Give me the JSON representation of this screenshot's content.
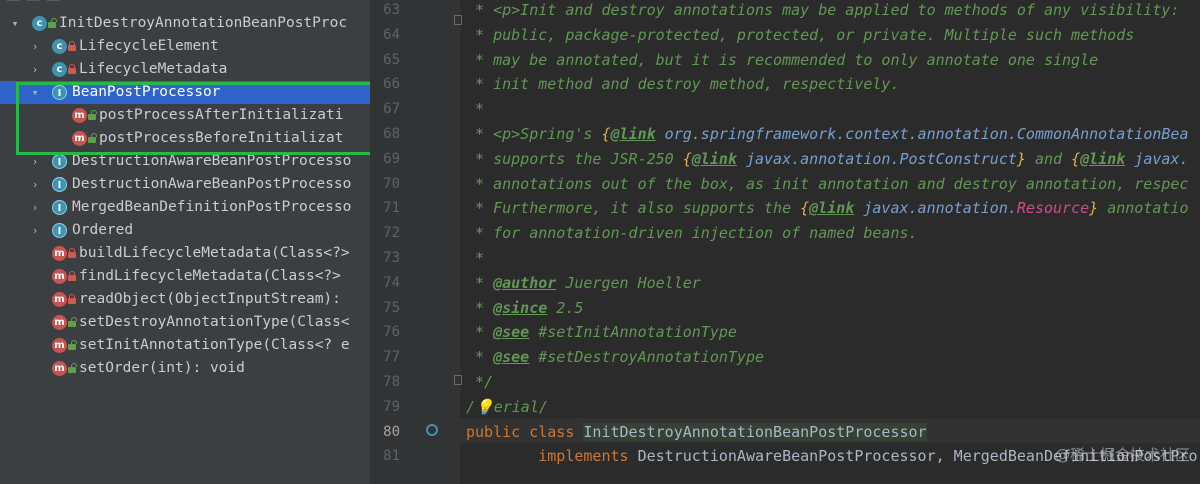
{
  "structure": {
    "items": [
      {
        "label": "InitDestroyAnnotationBeanPostProc",
        "arrow": "▾",
        "icon": "class-icon",
        "lock": "green",
        "indent": 0
      },
      {
        "label": "LifecycleElement",
        "arrow": "›",
        "icon": "class-icon",
        "lock": "red",
        "indent": 1
      },
      {
        "label": "LifecycleMetadata",
        "arrow": "›",
        "icon": "class-icon",
        "lock": "red",
        "indent": 1
      },
      {
        "label": "BeanPostProcessor",
        "arrow": "▾",
        "icon": "interface-icon",
        "lock": "",
        "indent": 1,
        "selected": true
      },
      {
        "label": "postProcessAfterInitializati",
        "arrow": "",
        "icon": "method-icon",
        "lock": "green",
        "indent": 2
      },
      {
        "label": "postProcessBeforeInitializat",
        "arrow": "",
        "icon": "method-icon",
        "lock": "green",
        "indent": 2
      },
      {
        "label": "DestructionAwareBeanPostProcesso",
        "arrow": "›",
        "icon": "interface-icon",
        "lock": "",
        "indent": 1
      },
      {
        "label": "DestructionAwareBeanPostProcesso",
        "arrow": "›",
        "icon": "interface-icon",
        "lock": "",
        "indent": 1
      },
      {
        "label": "MergedBeanDefinitionPostProcesso",
        "arrow": "›",
        "icon": "interface-icon",
        "lock": "",
        "indent": 1
      },
      {
        "label": "Ordered",
        "arrow": "›",
        "icon": "interface-icon",
        "lock": "",
        "indent": 1
      },
      {
        "label": "buildLifecycleMetadata(Class<?>",
        "arrow": "",
        "icon": "method-icon",
        "lock": "red",
        "indent": 1
      },
      {
        "label": "findLifecycleMetadata(Class<?>",
        "arrow": "",
        "icon": "method-icon",
        "lock": "red",
        "indent": 1
      },
      {
        "label": "readObject(ObjectInputStream):",
        "arrow": "",
        "icon": "method-icon",
        "lock": "red",
        "indent": 1
      },
      {
        "label": "setDestroyAnnotationType(Class<",
        "arrow": "",
        "icon": "method-icon",
        "lock": "green",
        "indent": 1
      },
      {
        "label": "setInitAnnotationType(Class<? e",
        "arrow": "",
        "icon": "method-icon",
        "lock": "green",
        "indent": 1
      },
      {
        "label": "setOrder(int): void",
        "arrow": "",
        "icon": "method-icon",
        "lock": "green",
        "indent": 1
      }
    ]
  },
  "editor": {
    "lines": [
      {
        "n": "63",
        "parts": [
          [
            "doc",
            " * <p>Init and destroy annotations may be applied to methods of any visibility:"
          ]
        ]
      },
      {
        "n": "64",
        "parts": [
          [
            "doc",
            " * public, package-protected, protected, or private. Multiple such methods"
          ]
        ]
      },
      {
        "n": "65",
        "parts": [
          [
            "doc",
            " * may be annotated, but it is recommended to only annotate one single"
          ]
        ]
      },
      {
        "n": "66",
        "parts": [
          [
            "doc",
            " * init method and destroy method, respectively."
          ]
        ]
      },
      {
        "n": "67",
        "parts": [
          [
            "doc",
            " *"
          ]
        ]
      },
      {
        "n": "68",
        "parts": [
          [
            "doc",
            " * <p>Spring's "
          ],
          [
            "brace",
            "{"
          ],
          [
            "linktag",
            "@link"
          ],
          [
            "link",
            " org.springframework.context.annotation.CommonAnnotationBea"
          ]
        ]
      },
      {
        "n": "69",
        "parts": [
          [
            "doc",
            " * supports the JSR-250 "
          ],
          [
            "brace",
            "{"
          ],
          [
            "linktag",
            "@link"
          ],
          [
            "link",
            " javax.annotation.PostConstruct"
          ],
          [
            "brace",
            "}"
          ],
          [
            "doc",
            " and "
          ],
          [
            "brace",
            "{"
          ],
          [
            "linktag",
            "@link"
          ],
          [
            "link",
            " javax."
          ]
        ]
      },
      {
        "n": "70",
        "parts": [
          [
            "doc",
            " * annotations out of the box, as init annotation and destroy annotation, respec"
          ]
        ]
      },
      {
        "n": "71",
        "parts": [
          [
            "doc",
            " * Furthermore, it also supports the "
          ],
          [
            "brace",
            "{"
          ],
          [
            "linktag",
            "@link"
          ],
          [
            "link",
            " javax.annotation."
          ],
          [
            "pink",
            "Resource"
          ],
          [
            "brace",
            "}"
          ],
          [
            "doc",
            " annotatio"
          ]
        ]
      },
      {
        "n": "72",
        "parts": [
          [
            "doc",
            " * for annotation-driven injection of named beans."
          ]
        ]
      },
      {
        "n": "73",
        "parts": [
          [
            "doc",
            " *"
          ]
        ]
      },
      {
        "n": "74",
        "parts": [
          [
            "doc",
            " * "
          ],
          [
            "tag",
            "@author"
          ],
          [
            "doc",
            " Juergen Hoeller"
          ]
        ]
      },
      {
        "n": "75",
        "parts": [
          [
            "doc",
            " * "
          ],
          [
            "tag",
            "@since"
          ],
          [
            "doc",
            " 2.5"
          ]
        ]
      },
      {
        "n": "76",
        "parts": [
          [
            "doc",
            " * "
          ],
          [
            "tag",
            "@see"
          ],
          [
            "doc",
            " #setInitAnnotationType"
          ]
        ]
      },
      {
        "n": "77",
        "parts": [
          [
            "doc",
            " * "
          ],
          [
            "tag",
            "@see"
          ],
          [
            "doc",
            " #setDestroyAnnotationType"
          ]
        ]
      },
      {
        "n": "78",
        "parts": [
          [
            "doc",
            " */"
          ]
        ]
      },
      {
        "n": "79",
        "parts": [
          [
            "doc",
            "/💡erial/"
          ]
        ]
      },
      {
        "n": "80",
        "parts": [
          [
            "kw",
            "public class "
          ],
          [
            "clshl",
            "InitDestroyAnnotationBeanPostProcessor"
          ]
        ]
      },
      {
        "n": "81",
        "parts": [
          [
            "kw",
            "        implements "
          ],
          [
            "type",
            "DestructionAwareBeanPostProcessor, MergedBeanDefinitionPostPro"
          ]
        ]
      }
    ],
    "active_line": "80"
  },
  "watermark": "@稀土掘金技术社区"
}
